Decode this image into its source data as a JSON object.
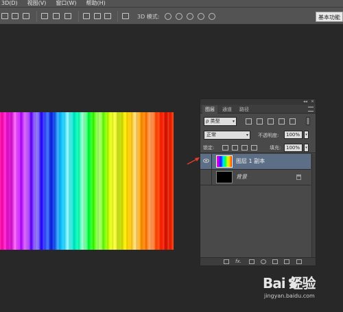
{
  "menu": {
    "items": [
      "3D(D)",
      "视图(V)",
      "窗口(W)",
      "帮助(H)"
    ]
  },
  "options_bar": {
    "mode_label": "3D 模式:",
    "workspace_button": "基本功能"
  },
  "panel": {
    "tabs": [
      {
        "label": "图层",
        "active": true
      },
      {
        "label": "通道",
        "active": false
      },
      {
        "label": "路径",
        "active": false
      }
    ],
    "filter": {
      "kind_label": "ρ 类型"
    },
    "blend_mode": "正常",
    "opacity_label": "不透明度:",
    "opacity_value": "100%",
    "lock_label": "锁定:",
    "fill_label": "填充:",
    "fill_value": "100%",
    "layers": [
      {
        "name": "图层 1 副本",
        "selected": true,
        "visible": true,
        "thumbnail": "rainbow",
        "locked": false
      },
      {
        "name": "背景",
        "selected": false,
        "visible": false,
        "thumbnail": "black",
        "locked": true
      }
    ],
    "bottom_icons": [
      "link-icon",
      "fx-icon",
      "mask-icon",
      "adjustment-icon",
      "group-folder-icon",
      "new-layer-icon",
      "trash-icon"
    ],
    "fx_label": "fx."
  },
  "watermark": {
    "logo": "Bai 经验",
    "url": "jingyan.baidu.com"
  },
  "colors": {
    "ui_dark": "#282828",
    "panel": "#494949",
    "selected_row": "#5d6f86",
    "arrow": "#e23c2a"
  }
}
